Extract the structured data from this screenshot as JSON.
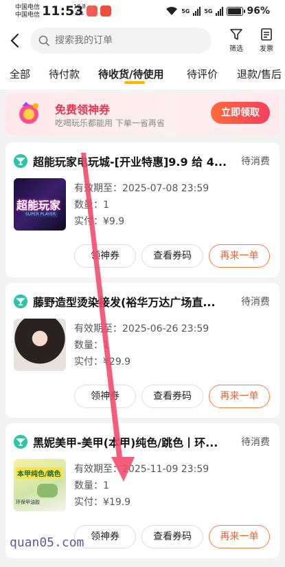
{
  "status_bar": {
    "carrier_1": "中国电信",
    "carrier_2": "中国电信",
    "time": "11:53",
    "net_speed_value": "10.8",
    "net_speed_unit": "K/s",
    "sig_1": "5G",
    "sig_2": "5G",
    "battery": "96%"
  },
  "header": {
    "search_placeholder": "搜索我的订单",
    "filter_label": "筛选",
    "invoice_label": "发票"
  },
  "tabs": [
    "全部",
    "待付款",
    "待收货/待使用",
    "待评价",
    "退款/售后"
  ],
  "promo": {
    "title": "免费领神券",
    "subtitle": "吃喝玩乐都能用 下单一省再省",
    "button": "立即领取"
  },
  "orders": [
    {
      "title": "超能玩家电玩城-[开业特惠]9.9 给 4...",
      "status": "待消费",
      "thumb_text": "超能玩家",
      "thumb_sub": "SUPER PLAYER",
      "expiry": "有效期至：2025-07-08 23:59",
      "quantity": "数量：1",
      "paid": "实付：¥9.9",
      "btn_coupon": "领神券",
      "btn_view": "查看券码",
      "btn_reorder": "再来一单"
    },
    {
      "title": "藤野造型烫染接发(裕华万达广场直...",
      "status": "待消费",
      "expiry": "有效期至：2025-06-26 23:59",
      "quantity": "数量：1",
      "paid": "实付：¥29.9",
      "btn_coupon": "领神券",
      "btn_view": "查看券码",
      "btn_reorder": "再来一单"
    },
    {
      "title": "黑妮美甲-美甲(本甲)纯色/跳色丨环...",
      "status": "待消费",
      "thumb_text": "本甲纯色/跳色",
      "thumb_sub": "环保甲油胶",
      "expiry": "有效期至：2025-11-09 23:59",
      "quantity": "数量：1",
      "paid": "实付：¥19.9",
      "btn_coupon": "领神券",
      "btn_view": "查看券码",
      "btn_reorder": "再来一单"
    }
  ],
  "watermark": "quan05.com",
  "colors": {
    "accent": "#ffb400",
    "promo_red": "#e8344e",
    "reorder": "#ff5a1f",
    "tag_teal": "#2ec4a8"
  }
}
